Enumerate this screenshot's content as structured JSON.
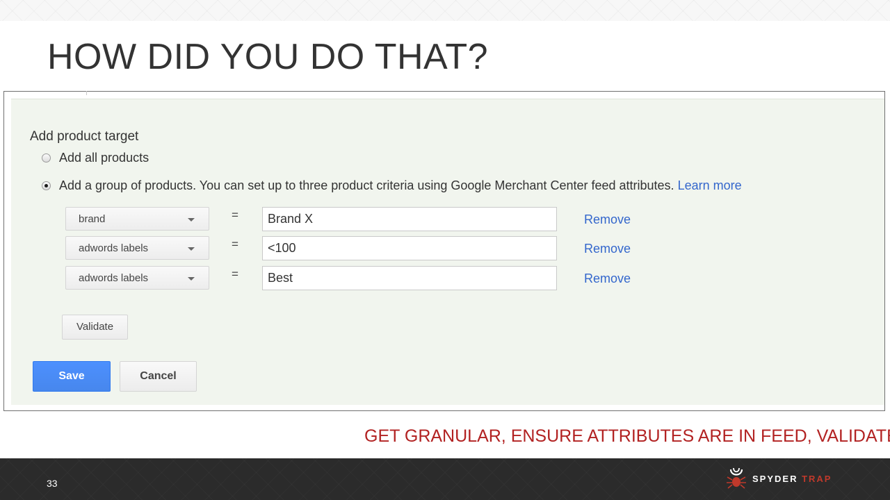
{
  "slide": {
    "title": "HOW DID YOU DO THAT?",
    "tagline": "GET GRANULAR, ENSURE ATTRIBUTES ARE IN FEED, VALIDATE",
    "page_number": "33"
  },
  "logo": {
    "word1": "SPYDER",
    "word2": "TRAP"
  },
  "form": {
    "title": "Add product target",
    "options": [
      {
        "label": "Add all products",
        "checked": false
      },
      {
        "label": "Add a group of products. You can set up to three product criteria using Google Merchant Center feed attributes.",
        "checked": true
      }
    ],
    "learn_more": "Learn more",
    "criteria": [
      {
        "attribute": "brand",
        "operator": "=",
        "value": "Brand X",
        "remove": "Remove"
      },
      {
        "attribute": "adwords labels",
        "operator": "=",
        "value": "<100",
        "remove": "Remove"
      },
      {
        "attribute": "adwords labels",
        "operator": "=",
        "value": "Best",
        "remove": "Remove"
      }
    ],
    "validate_label": "Validate",
    "save_label": "Save",
    "cancel_label": "Cancel"
  },
  "colors": {
    "tagline": "#b22222",
    "link": "#3366cc",
    "save_button": "#4d90fe",
    "panel_background": "#f1f5ee",
    "footer": "#2b2b2b",
    "logo_accent": "#c0392b"
  },
  "icons": {
    "dropdown": "chevron-down-icon",
    "logo": "spider-icon"
  }
}
